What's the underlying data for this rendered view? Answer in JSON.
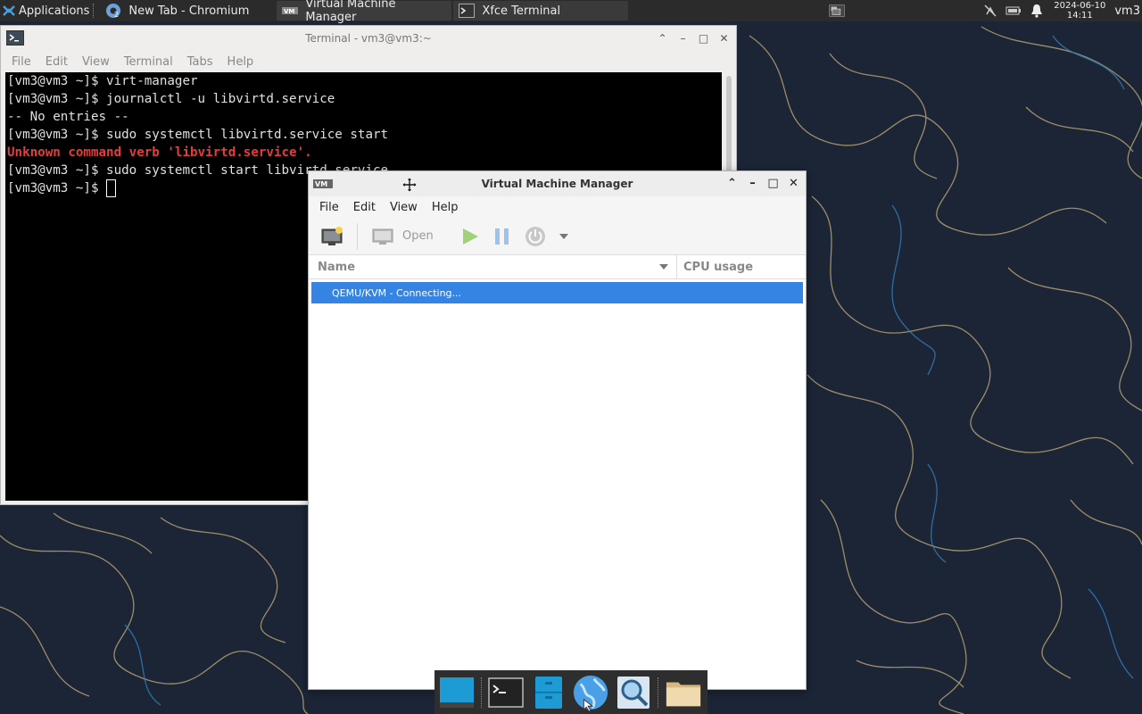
{
  "top_panel": {
    "applications_label": "Applications",
    "tasks": [
      {
        "label": "New Tab - Chromium",
        "icon": "chromium-icon"
      },
      {
        "label": "Virtual Machine Manager",
        "icon": "virt-manager-icon"
      },
      {
        "label": "Xfce Terminal",
        "icon": "terminal-icon"
      }
    ],
    "clock_date": "2024-06-10",
    "clock_time": "14:11",
    "user": "vm3"
  },
  "terminal": {
    "title": "Terminal - vm3@vm3:~",
    "menu": [
      "File",
      "Edit",
      "View",
      "Terminal",
      "Tabs",
      "Help"
    ],
    "lines": [
      "[vm3@vm3 ~]$ virt-manager",
      "[vm3@vm3 ~]$ journalctl -u libvirtd.service",
      "-- No entries --",
      "[vm3@vm3 ~]$ sudo systemctl libvirtd.service start",
      "Unknown command verb 'libvirtd.service'.",
      "[vm3@vm3 ~]$ sudo systemctl start libvirtd.service",
      "[vm3@vm3 ~]$ "
    ]
  },
  "vmm": {
    "title": "Virtual Machine Manager",
    "menu": [
      "File",
      "Edit",
      "View",
      "Help"
    ],
    "toolbar": {
      "open_label": "Open"
    },
    "columns": {
      "name": "Name",
      "cpu": "CPU usage"
    },
    "rows": [
      {
        "label": "QEMU/KVM - Connecting..."
      }
    ]
  },
  "colors": {
    "selection": "#3584e4",
    "terminal_error": "#e33d3d",
    "wallpaper_bg": "#1c2536"
  },
  "dock": {
    "items": [
      "desktop-icon",
      "terminal-icon",
      "file-manager-icon",
      "web-browser-icon",
      "app-finder-icon",
      "folder-icon"
    ]
  }
}
